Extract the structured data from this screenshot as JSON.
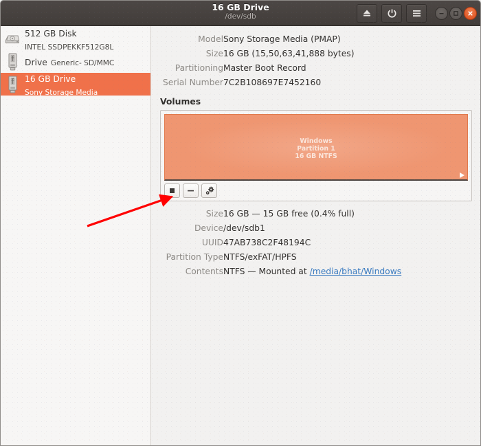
{
  "window": {
    "title": "16 GB Drive",
    "subtitle": "/dev/sdb",
    "header_buttons": [
      {
        "name": "eject-button",
        "icon": "eject-icon",
        "label": "Eject"
      },
      {
        "name": "power-button",
        "icon": "power-icon",
        "label": "Power Off"
      },
      {
        "name": "menu-button",
        "icon": "hamburger-menu-icon",
        "label": "Menu"
      }
    ],
    "window_controls": [
      {
        "name": "minimize-button",
        "icon": "minimize-icon",
        "label": "Minimize"
      },
      {
        "name": "maximize-button",
        "icon": "maximize-icon",
        "label": "Maximize"
      },
      {
        "name": "close-button",
        "icon": "close-icon",
        "label": "Close"
      }
    ]
  },
  "sidebar": {
    "items": [
      {
        "name": "512 GB Disk",
        "sub": "INTEL SSDPEKKF512G8L",
        "icon": "hard-disk-icon",
        "selected": false
      },
      {
        "name": "Drive",
        "sub": "Generic- SD/MMC",
        "icon": "usb-drive-icon",
        "selected": false
      },
      {
        "name": "16 GB Drive",
        "sub": "Sony Storage Media",
        "icon": "usb-drive-icon",
        "selected": true
      }
    ]
  },
  "drive_details": {
    "rows": [
      {
        "label": "Model",
        "value": "Sony Storage Media (PMAP)"
      },
      {
        "label": "Size",
        "value": "16 GB (15,50,63,41,888 bytes)"
      },
      {
        "label": "Partitioning",
        "value": "Master Boot Record"
      },
      {
        "label": "Serial Number",
        "value": "7C2B108697E7452160"
      }
    ]
  },
  "volumes": {
    "heading": "Volumes",
    "partition": {
      "line1": "Windows",
      "line2": "Partition 1",
      "line3": "16 GB NTFS"
    },
    "toolbar": [
      {
        "name": "unmount-volume-button",
        "icon": "stop-square-icon",
        "label": "Unmount selected partition"
      },
      {
        "name": "delete-volume-button",
        "icon": "minus-icon",
        "label": "Delete selected partition"
      },
      {
        "name": "volume-options-button",
        "icon": "gear-icon",
        "label": "More actions"
      }
    ]
  },
  "volume_details": {
    "rows": [
      {
        "label": "Size",
        "value": "16 GB — 15 GB free (0.4% full)",
        "link": null
      },
      {
        "label": "Device",
        "value": "/dev/sdb1",
        "link": null
      },
      {
        "label": "UUID",
        "value": "47AB738C2F48194C",
        "link": null
      },
      {
        "label": "Partition Type",
        "value": "NTFS/exFAT/HPFS",
        "link": null
      },
      {
        "label": "Contents",
        "value": "NTFS — Mounted at ",
        "link": "/media/bhat/Windows"
      }
    ]
  },
  "annotation": {
    "arrow_color": "#ff0000",
    "points_to": "unmount-volume-button"
  },
  "colors": {
    "titlebar": "#47423f",
    "selection": "#f0714a",
    "partition": "#ef9671",
    "background": "#f2f1f0",
    "link": "#3a7bc0"
  }
}
